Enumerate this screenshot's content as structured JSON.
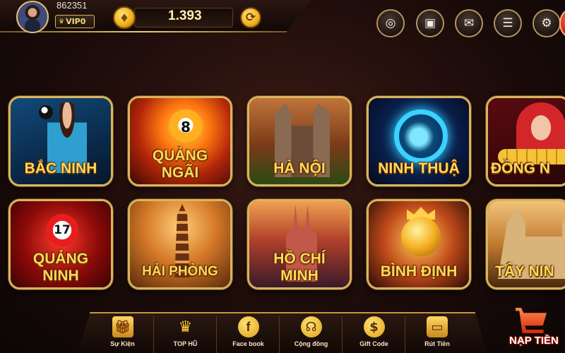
{
  "header": {
    "user_id": "862351",
    "vip_level": "VIP0",
    "balance": "1.393",
    "icons": [
      "chip-icon",
      "safe-icon",
      "mail-icon",
      "news-icon",
      "gear-icon"
    ]
  },
  "games": [
    {
      "label": "BẮC NINH",
      "art": "bacninh"
    },
    {
      "label": "QUẢNG\nNGÃI",
      "art": "quangngai"
    },
    {
      "label": "HÀ NỘI",
      "art": "hanoi"
    },
    {
      "label": "NINH THUẬ",
      "art": "ninhthuan"
    },
    {
      "label": "ĐỒNG N",
      "art": "dongnai"
    },
    {
      "label": "QUẢNG\nNINH",
      "art": "quangninh"
    },
    {
      "label": "HẢI PHÒNG",
      "art": "haiphong"
    },
    {
      "label": "HỒ CHÍ\nMINH",
      "art": "hochiminh"
    },
    {
      "label": "BÌNH ĐỊNH",
      "art": "binhdinh"
    },
    {
      "label": "TÂY NIN",
      "art": "tayninh"
    }
  ],
  "bottom_nav": [
    {
      "label": "Sự Kiện",
      "icon": "gift-icon"
    },
    {
      "label": "TOP HŨ",
      "icon": "crown-icon"
    },
    {
      "label": "Face book",
      "icon": "facebook-icon"
    },
    {
      "label": "Cộng đồng",
      "icon": "headset-icon"
    },
    {
      "label": "Gift Code",
      "icon": "coins-icon"
    },
    {
      "label": "Rút Tiền",
      "icon": "wallet-icon"
    }
  ],
  "deposit": {
    "label": "NẠP TIỀN",
    "icon": "cart-icon"
  },
  "colors": {
    "accent_gold": "#d9b45e",
    "label_yellow": "#ffd95a",
    "deposit_red": "#d3260c"
  }
}
